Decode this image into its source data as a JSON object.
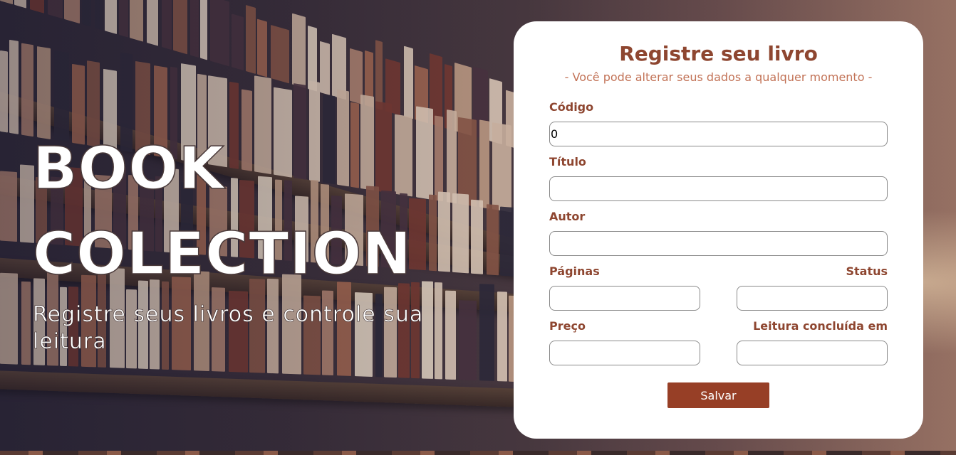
{
  "hero": {
    "title_line1": "BOOK",
    "title_line2": "COLECTION",
    "subtitle": "Registre seus livros e controle sua leitura"
  },
  "form": {
    "title": "Registre seu livro",
    "subtitle": "- Você pode alterar seus dados a qualquer momento -",
    "fields": {
      "codigo": {
        "label": "Código",
        "value": "0"
      },
      "titulo": {
        "label": "Título",
        "value": ""
      },
      "autor": {
        "label": "Autor",
        "value": ""
      },
      "paginas": {
        "label": "Páginas",
        "value": ""
      },
      "status": {
        "label": "Status",
        "value": ""
      },
      "preco": {
        "label": "Preço",
        "value": ""
      },
      "leitura": {
        "label": "Leitura concluída em",
        "value": ""
      }
    },
    "save_label": "Salvar"
  },
  "colors": {
    "accent": "#8e4630",
    "subtitle": "#c27256",
    "button": "#973f26",
    "card": "#ffffff"
  }
}
